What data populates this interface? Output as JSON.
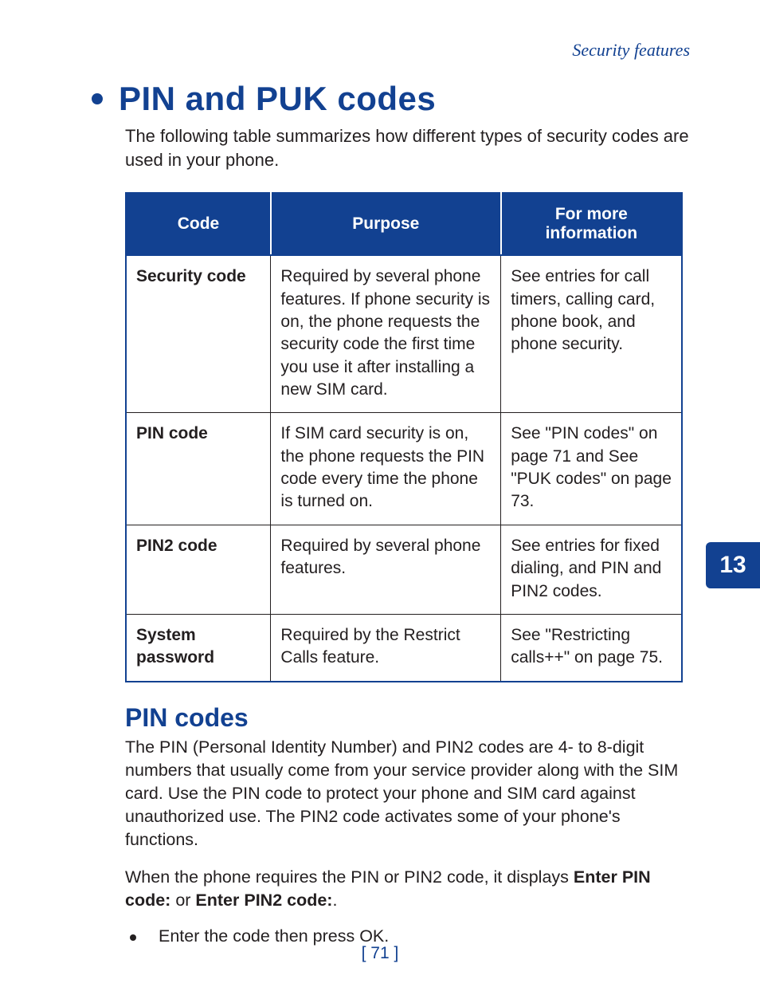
{
  "header": {
    "section_label": "Security features"
  },
  "title": "PIN and PUK codes",
  "intro": "The following table summarizes how different types of security codes are used in your phone.",
  "table": {
    "headers": [
      "Code",
      "Purpose",
      "For more information"
    ],
    "rows": [
      {
        "code": "Security code",
        "purpose": "Required by several phone features. If phone security is on, the phone requests the security code the first time you use it after installing a new SIM card.",
        "info": "See entries for call timers, calling card, phone book, and phone security."
      },
      {
        "code": "PIN code",
        "purpose": "If SIM card security is on, the phone requests the PIN code every time the phone is turned on.",
        "info": "See \"PIN codes\" on page 71 and See \"PUK codes\" on page 73."
      },
      {
        "code": "PIN2 code",
        "purpose": "Required by several phone features.",
        "info": "See entries for fixed dialing, and PIN and PIN2 codes."
      },
      {
        "code": "System password",
        "purpose": "Required by the Restrict Calls feature.",
        "info": "See \"Restricting calls++\" on page 75."
      }
    ]
  },
  "subheading": "PIN codes",
  "para1": "The PIN (Personal Identity Number) and PIN2 codes are 4- to 8-digit numbers that usually come from your service provider along with the SIM card. Use the PIN code to protect your phone and SIM card against unauthorized use. The PIN2 code activates some of your phone's functions.",
  "para2_pre": "When the phone requires the PIN or PIN2 code, it displays ",
  "para2_bold1": "Enter PIN code:",
  "para2_mid": " or ",
  "para2_bold2": "Enter PIN2 code:",
  "para2_post": ".",
  "bullet_pre": "Enter the code then press ",
  "bullet_bold": "OK",
  "bullet_post": ".",
  "chapter": "13",
  "page_number": "[ 71 ]"
}
